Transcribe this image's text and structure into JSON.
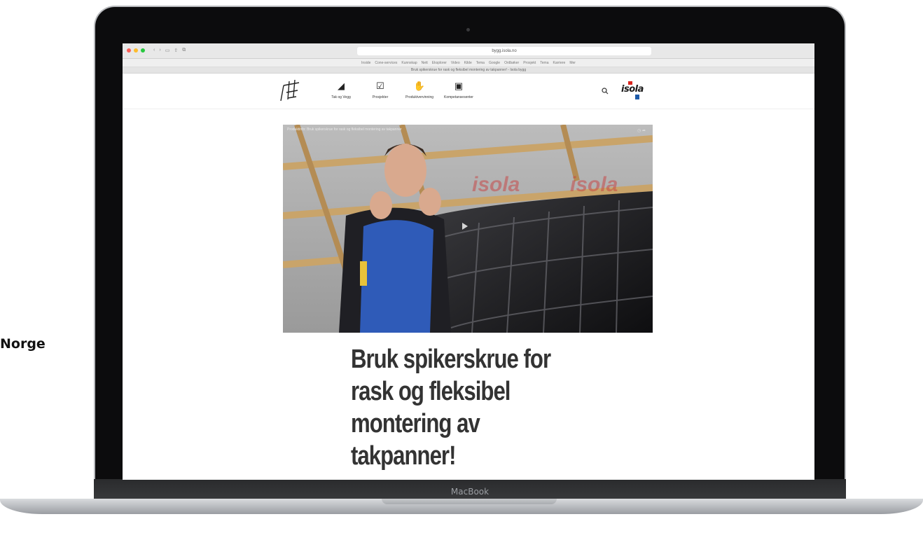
{
  "side_label": "Norge",
  "device": {
    "brand": "MacBook"
  },
  "browser": {
    "url": "bygg.isola.no",
    "page_title": "Bruk spikerskrue for rask og fleksibel montering av takpanner! - Isola bygg",
    "bookmarks": [
      "Inside",
      "Cone-services",
      "Kunnskap",
      "Nett",
      "Eksplorer",
      "Video",
      "Kilde",
      "Tema",
      "Google",
      "Ordbøker",
      "Prosjekt",
      "Tema",
      "Karriere",
      "Mer"
    ]
  },
  "site": {
    "nav": [
      {
        "label": "Tak og Vegg",
        "icon": "triangle-icon"
      },
      {
        "label": "Prosjekter",
        "icon": "checklist-icon"
      },
      {
        "label": "Produktvervinning",
        "icon": "hand-icon"
      },
      {
        "label": "Kompetansesenter",
        "icon": "chat-icon"
      }
    ],
    "logo_text": "isola"
  },
  "video": {
    "title": "Produktinfo: Bruk spikerskrue for rask og fleksibel montering av takpanner"
  },
  "article": {
    "headline_lines": [
      "Bruk spikerskrue for",
      "rask og fleksibel",
      "montering av",
      "takpanner!"
    ]
  },
  "colors": {
    "isola_red": "#d9251d",
    "isola_blue": "#1e5aa8",
    "headline": "#333333"
  }
}
